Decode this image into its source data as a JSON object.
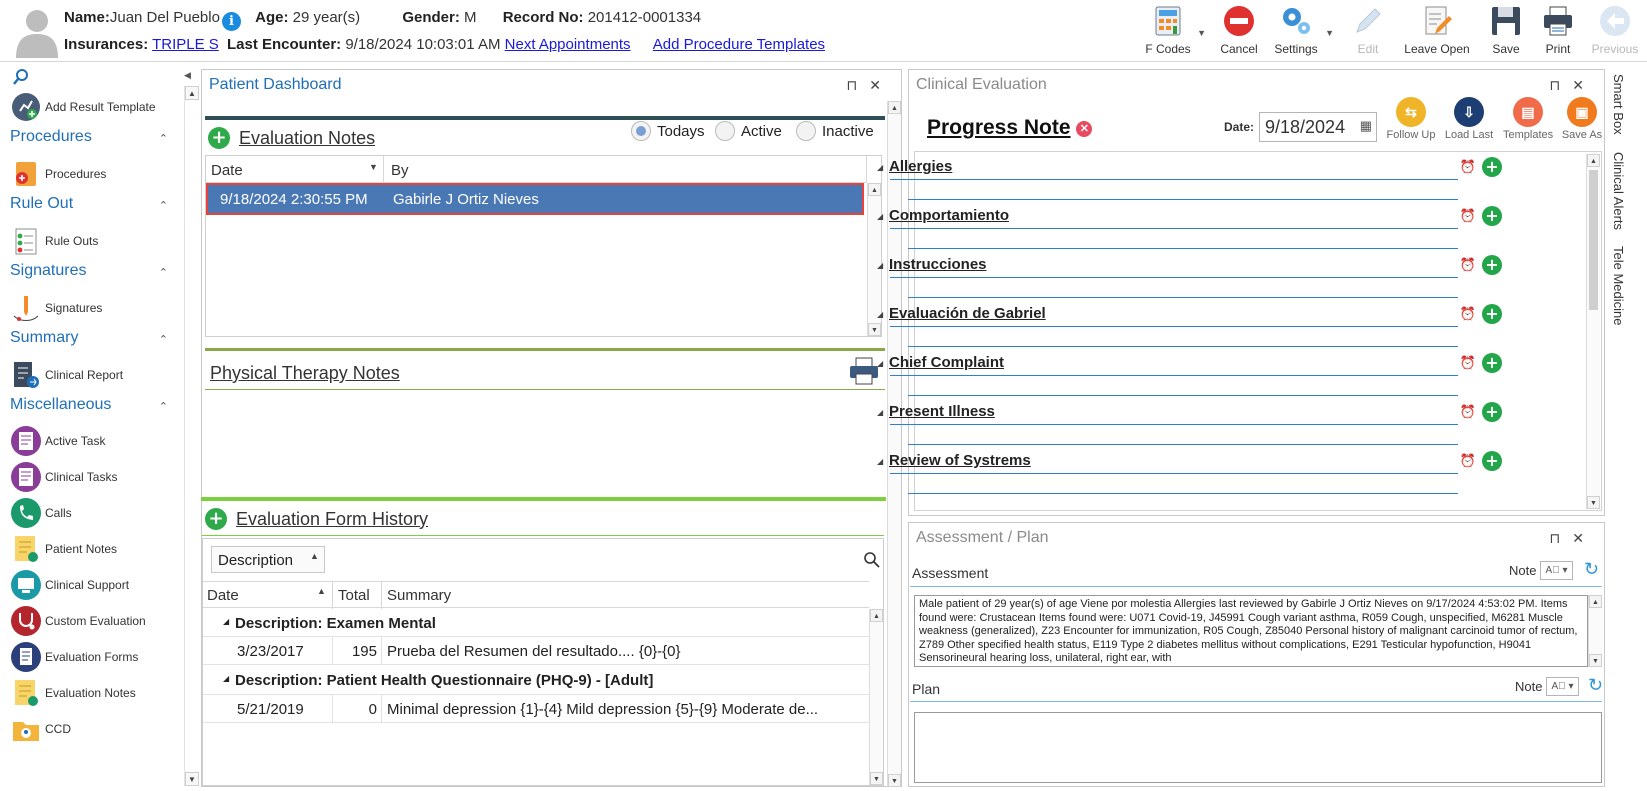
{
  "patient": {
    "name_label": "Name:",
    "name": "Juan Del Pueblo",
    "age_label": "Age:",
    "age": "29 year(s)",
    "gender_label": "Gender:",
    "gender": "M",
    "record_label": "Record No:",
    "record": "201412-0001334",
    "insurances_label": "Insurances:",
    "insurance": "TRIPLE S",
    "last_encounter_label": "Last Encounter:",
    "last_encounter": "9/18/2024 10:03:01 AM",
    "next_appointments": "Next Appointments",
    "add_procedure_templates": "Add Procedure Templates"
  },
  "toolbar": {
    "fcodes": "F Codes",
    "cancel": "Cancel",
    "settings": "Settings",
    "edit": "Edit",
    "leave_open": "Leave Open",
    "save": "Save",
    "print": "Print",
    "previous": "Previous"
  },
  "sidebar": {
    "add_result_template": "Add Result Template",
    "sections": [
      {
        "title": "Procedures",
        "item": "Procedures"
      },
      {
        "title": "Rule Out",
        "item": "Rule Outs"
      },
      {
        "title": "Signatures",
        "item": "Signatures"
      },
      {
        "title": "Summary",
        "item": "Clinical Report"
      }
    ],
    "misc_title": "Miscellaneous",
    "misc_items": [
      "Active Task",
      "Clinical Tasks",
      "Calls",
      "Patient Notes",
      "Clinical Support",
      "Custom Evaluation",
      "Evaluation Forms",
      "Evaluation Notes",
      "CCD"
    ]
  },
  "dashboard": {
    "title": "Patient Dashboard",
    "eval_notes_title": "Evaluation Notes",
    "radios": [
      "Todays",
      "Active",
      "Inactive"
    ],
    "selected_radio": "Todays",
    "columns": [
      "Date",
      "By"
    ],
    "rows": [
      {
        "date": "9/18/2024 2:30:55 PM",
        "by": "Gabirle J Ortiz Nieves"
      }
    ],
    "pt_notes_title": "Physical Therapy Notes",
    "history_title": "Evaluation Form History",
    "history_group_by": "Description",
    "history_columns": [
      "Date",
      "Total",
      "Summary"
    ],
    "history_groups": [
      {
        "label": "Description: Examen Mental",
        "rows": [
          {
            "date": "3/23/2017",
            "total": "195",
            "summary": "Prueba del Resumen del resultado.... {0}-{0}"
          }
        ]
      },
      {
        "label": "Description: Patient Health Questionnaire (PHQ-9) - [Adult]",
        "rows": [
          {
            "date": "5/21/2019",
            "total": "0",
            "summary": "Minimal depression {1}-{4}  Mild depression {5}-{9}  Moderate de..."
          }
        ]
      }
    ]
  },
  "clinical_eval": {
    "title": "Clinical Evaluation",
    "note_title": "Progress Note",
    "date_label": "Date:",
    "date_value": "9/18/2024",
    "tools": [
      "Follow Up",
      "Load Last",
      "Templates",
      "Save As"
    ],
    "sections": [
      "Allergies",
      "Comportamiento",
      "Instrucciones",
      "Evaluación de Gabriel",
      "Chief Complaint",
      "Present Illness",
      "Review of Systrems"
    ]
  },
  "side_tabs": [
    "Smart Box",
    "Clinical Alerts",
    "Tele Medicine"
  ],
  "assessment_plan": {
    "title": "Assessment / Plan",
    "assessment_label": "Assessment",
    "note_label": "Note",
    "assessment_text": "Male patient of 29 year(s) of age Viene por molestia     Allergies last reviewed by Gabirle J Ortiz Nieves on 9/17/2024 4:53:02 PM.   Items found were:  Crustacean  Items found were:  U071 Covid-19, J45991 Cough variant asthma, R059 Cough, unspecified, M6281 Muscle weakness (generalized), Z23 Encounter for immunization, R05 Cough, Z85040 Personal history of malignant carcinoid tumor of rectum, Z789 Other specified health status, E119 Type 2 diabetes mellitus without complications, E291 Testicular hypofunction, H9041 Sensorineural hearing loss, unilateral, right ear, with",
    "plan_label": "Plan",
    "plan_text": ""
  }
}
